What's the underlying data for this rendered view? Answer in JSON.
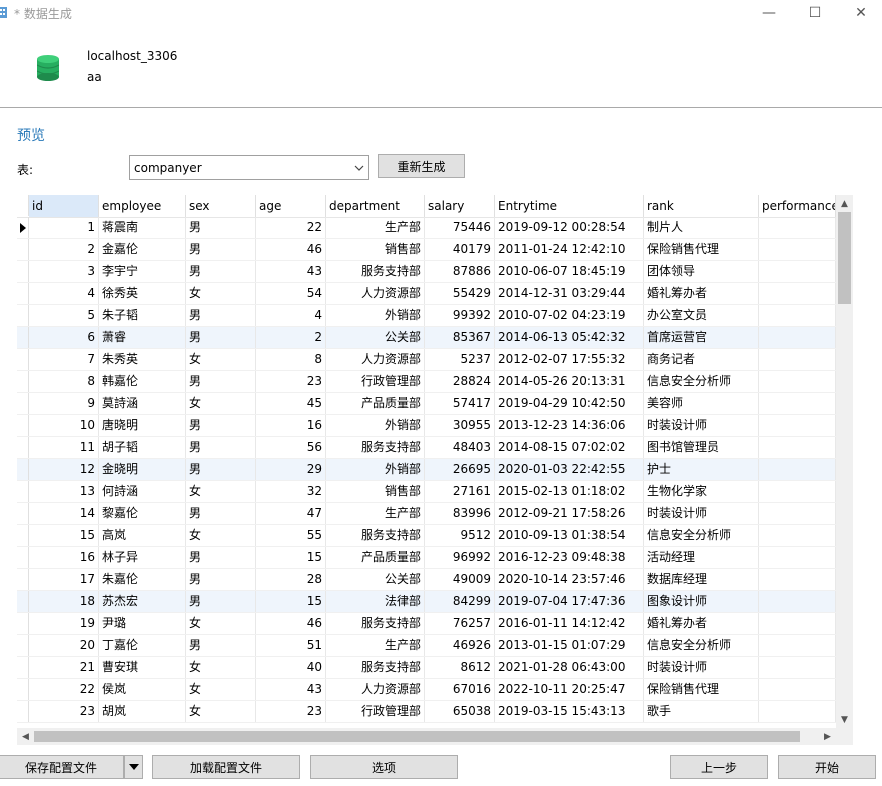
{
  "window": {
    "title": "* 数据生成",
    "minimize_glyph": "—",
    "maximize_glyph": "☐",
    "close_glyph": "✕"
  },
  "connection": {
    "name": "localhost_3306",
    "database": "aa",
    "icon": "database-icon",
    "icon_color": "#27ae60"
  },
  "section_title": "预览",
  "table_selector": {
    "label": "表:",
    "value": "companyer",
    "regenerate_label": "重新生成"
  },
  "grid": {
    "columns": [
      "id",
      "employee",
      "sex",
      "age",
      "department",
      "salary",
      "Entrytime",
      "rank",
      "performance"
    ],
    "rows": [
      [
        "1",
        "蒋震南",
        "男",
        "22",
        "生产部",
        "75446",
        "2019-09-12 00:28:54",
        "制片人",
        ""
      ],
      [
        "2",
        "金嘉伦",
        "男",
        "46",
        "销售部",
        "40179",
        "2011-01-24 12:42:10",
        "保险销售代理",
        ""
      ],
      [
        "3",
        "李宇宁",
        "男",
        "43",
        "服务支持部",
        "87886",
        "2010-06-07 18:45:19",
        "团体领导",
        ""
      ],
      [
        "4",
        "徐秀英",
        "女",
        "54",
        "人力资源部",
        "55429",
        "2014-12-31 03:29:44",
        "婚礼筹办者",
        ""
      ],
      [
        "5",
        "朱子韬",
        "男",
        "4",
        "外销部",
        "99392",
        "2010-07-02 04:23:19",
        "办公室文员",
        ""
      ],
      [
        "6",
        "萧睿",
        "男",
        "2",
        "公关部",
        "85367",
        "2014-06-13 05:42:32",
        "首席运营官",
        ""
      ],
      [
        "7",
        "朱秀英",
        "女",
        "8",
        "人力资源部",
        "5237",
        "2012-02-07 17:55:32",
        "商务记者",
        ""
      ],
      [
        "8",
        "韩嘉伦",
        "男",
        "23",
        "行政管理部",
        "28824",
        "2014-05-26 20:13:31",
        "信息安全分析师",
        ""
      ],
      [
        "9",
        "莫詩涵",
        "女",
        "45",
        "产品质量部",
        "57417",
        "2019-04-29 10:42:50",
        "美容师",
        ""
      ],
      [
        "10",
        "唐晓明",
        "男",
        "16",
        "外销部",
        "30955",
        "2013-12-23 14:36:06",
        "时装设计师",
        ""
      ],
      [
        "11",
        "胡子韬",
        "男",
        "56",
        "服务支持部",
        "48403",
        "2014-08-15 07:02:02",
        "图书馆管理员",
        ""
      ],
      [
        "12",
        "金晓明",
        "男",
        "29",
        "外销部",
        "26695",
        "2020-01-03 22:42:55",
        "护士",
        ""
      ],
      [
        "13",
        "何詩涵",
        "女",
        "32",
        "销售部",
        "27161",
        "2015-02-13 01:18:02",
        "生物化学家",
        ""
      ],
      [
        "14",
        "黎嘉伦",
        "男",
        "47",
        "生产部",
        "83996",
        "2012-09-21 17:58:26",
        "时装设计师",
        ""
      ],
      [
        "15",
        "高岚",
        "女",
        "55",
        "服务支持部",
        "9512",
        "2010-09-13 01:38:54",
        "信息安全分析师",
        ""
      ],
      [
        "16",
        "林子异",
        "男",
        "15",
        "产品质量部",
        "96992",
        "2016-12-23 09:48:38",
        "活动经理",
        ""
      ],
      [
        "17",
        "朱嘉伦",
        "男",
        "28",
        "公关部",
        "49009",
        "2020-10-14 23:57:46",
        "数据库经理",
        ""
      ],
      [
        "18",
        "苏杰宏",
        "男",
        "15",
        "法律部",
        "84299",
        "2019-07-04 17:47:36",
        "图象设计师",
        ""
      ],
      [
        "19",
        "尹璐",
        "女",
        "46",
        "服务支持部",
        "76257",
        "2016-01-11 14:12:42",
        "婚礼筹办者",
        ""
      ],
      [
        "20",
        "丁嘉伦",
        "男",
        "51",
        "生产部",
        "46926",
        "2013-01-15 01:07:29",
        "信息安全分析师",
        ""
      ],
      [
        "21",
        "曹安琪",
        "女",
        "40",
        "服务支持部",
        "8612",
        "2021-01-28 06:43:00",
        "时装设计师",
        ""
      ],
      [
        "22",
        "侯岚",
        "女",
        "43",
        "人力资源部",
        "67016",
        "2022-10-11 20:25:47",
        "保险销售代理",
        ""
      ],
      [
        "23",
        "胡岚",
        "女",
        "23",
        "行政管理部",
        "65038",
        "2019-03-15 15:43:13",
        "歌手",
        ""
      ]
    ]
  },
  "buttons": {
    "save_config": "保存配置文件",
    "load_config": "加载配置文件",
    "options": "选项",
    "prev_step": "上一步",
    "start": "开始"
  },
  "colors": {
    "accent": "#2a7ab9",
    "row_alt": "#eff5fc",
    "header_selected": "#dbe9f9"
  }
}
